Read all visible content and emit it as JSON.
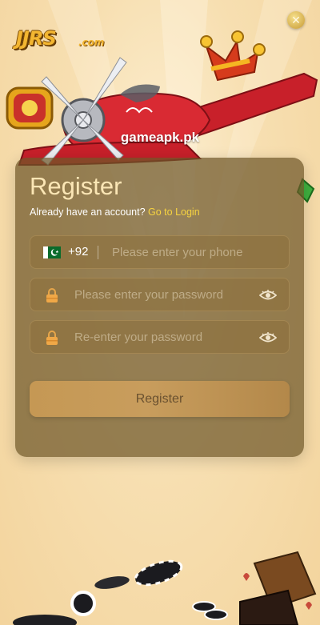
{
  "brand": {
    "logo": "JJRS.com",
    "logo_main": "JJRS",
    "logo_suffix": ".com"
  },
  "watermark": "gameapk.pk",
  "form": {
    "title": "Register",
    "have_account_text": "Already have an account?",
    "login_link": "Go to Login",
    "phone": {
      "country_code": "+92",
      "placeholder": "Please enter your phone",
      "value": ""
    },
    "password": {
      "placeholder": "Please enter your password",
      "value": ""
    },
    "confirm_password": {
      "placeholder": "Re-enter your password",
      "value": ""
    },
    "submit_label": "Register"
  },
  "icons": {
    "close": "close-icon",
    "flag": "pakistan-flag-icon",
    "lock": "lock-icon",
    "eye": "eye-icon"
  },
  "colors": {
    "accent_link": "#f7d340",
    "title": "#fbe6b5",
    "button": "#c59854",
    "background": "#f7dfb1"
  }
}
